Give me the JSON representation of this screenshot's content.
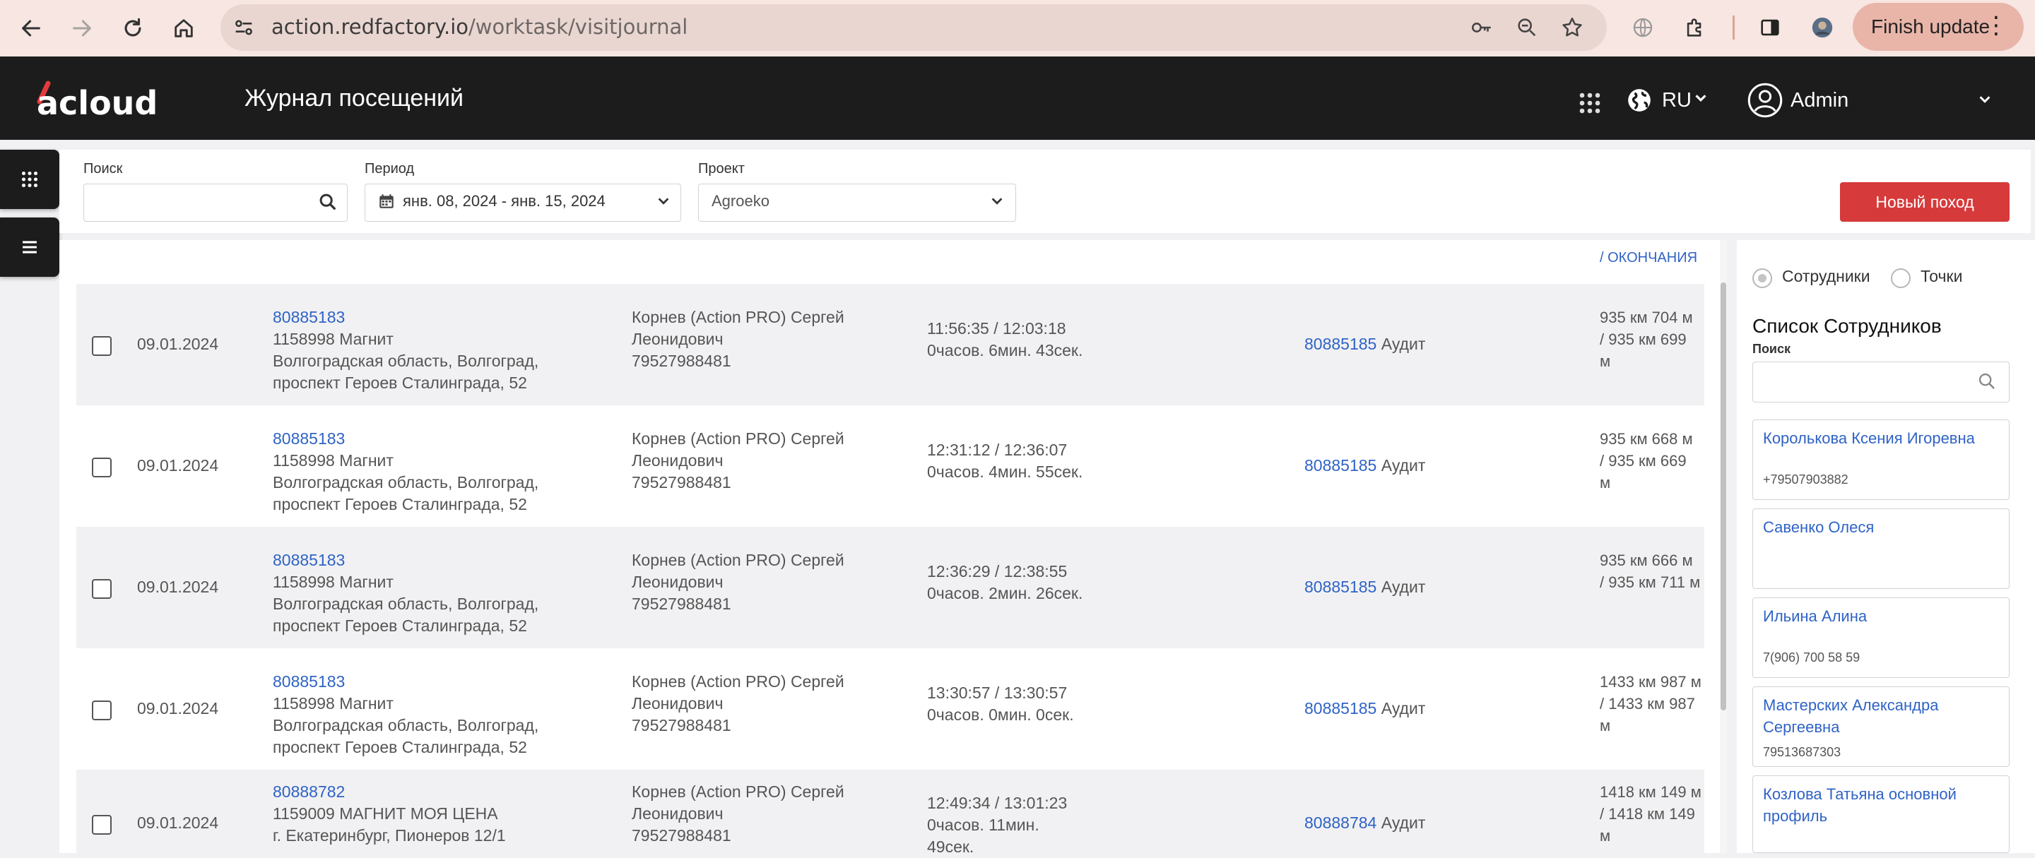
{
  "browser": {
    "url_host": "action.redfactory.io",
    "url_path": "/worktask/visitjournal",
    "finish_update_label": "Finish update"
  },
  "header": {
    "logo_text": "acloud",
    "title": "Журнал посещений",
    "lang": "RU",
    "user": "Admin"
  },
  "filters": {
    "search_label": "Поиск",
    "search_value": "",
    "period_label": "Период",
    "period_value": "янв. 08, 2024 - янв. 15, 2024",
    "project_label": "Проект",
    "project_value": "Agroeko",
    "new_trip_label": "Новый поход"
  },
  "table": {
    "end_column_header": "/ ОКОНЧАНИЯ",
    "rows": [
      {
        "date": "09.01.2024",
        "point_id": "80885183",
        "point_name": "1158998 Магнит",
        "addr1": "Волгоградская область, Волгоград,",
        "addr2": "проспект Героев Сталинграда, 52",
        "emp1": "Корнев (Action PRO) Сергей",
        "emp2": "Леонидович",
        "emp3": "79527988481",
        "time1": "11:56:35 / 12:03:18",
        "time2": "0часов. 6мин. 43сек.",
        "time3": "",
        "task_id": "80885185",
        "task_type": "Аудит",
        "dist1": "935 км 704 м",
        "dist2": "/ 935 км 699",
        "dist3": "м"
      },
      {
        "date": "09.01.2024",
        "point_id": "80885183",
        "point_name": "1158998 Магнит",
        "addr1": "Волгоградская область, Волгоград,",
        "addr2": "проспект Героев Сталинграда, 52",
        "emp1": "Корнев (Action PRO) Сергей",
        "emp2": "Леонидович",
        "emp3": "79527988481",
        "time1": "12:31:12 / 12:36:07",
        "time2": "0часов. 4мин. 55сек.",
        "time3": "",
        "task_id": "80885185",
        "task_type": "Аудит",
        "dist1": "935 км 668 м",
        "dist2": "/ 935 км 669",
        "dist3": "м"
      },
      {
        "date": "09.01.2024",
        "point_id": "80885183",
        "point_name": "1158998 Магнит",
        "addr1": "Волгоградская область, Волгоград,",
        "addr2": "проспект Героев Сталинграда, 52",
        "emp1": "Корнев (Action PRO) Сергей",
        "emp2": "Леонидович",
        "emp3": "79527988481",
        "time1": "12:36:29 / 12:38:55",
        "time2": "0часов. 2мин. 26сек.",
        "time3": "",
        "task_id": "80885185",
        "task_type": "Аудит",
        "dist1": "935 км 666 м",
        "dist2": "/ 935 км 711 м",
        "dist3": ""
      },
      {
        "date": "09.01.2024",
        "point_id": "80885183",
        "point_name": "1158998 Магнит",
        "addr1": "Волгоградская область, Волгоград,",
        "addr2": "проспект Героев Сталинграда, 52",
        "emp1": "Корнев (Action PRO) Сергей",
        "emp2": "Леонидович",
        "emp3": "79527988481",
        "time1": "13:30:57 / 13:30:57",
        "time2": "0часов. 0мин. 0сек.",
        "time3": "",
        "task_id": "80885185",
        "task_type": "Аудит",
        "dist1": "1433 км 987 м",
        "dist2": "/ 1433 км 987",
        "dist3": "м"
      },
      {
        "date": "09.01.2024",
        "point_id": "80888782",
        "point_name": "1159009 МАГНИТ МОЯ ЦЕНА",
        "addr1": "г. Екатеринбург, Пионеров 12/1",
        "addr2": "",
        "emp1": "Корнев (Action PRO) Сергей",
        "emp2": "Леонидович",
        "emp3": "79527988481",
        "time1": "12:49:34 / 13:01:23",
        "time2": "0часов. 11мин.",
        "time3": "49сек.",
        "task_id": "80888784",
        "task_type": "Аудит",
        "dist1": "1418 км 149 м",
        "dist2": "/ 1418 км 149",
        "dist3": "м"
      }
    ]
  },
  "right_panel": {
    "radio_employees": "Сотрудники",
    "radio_points": "Точки",
    "title": "Список Сотрудников",
    "search_label": "Поиск",
    "employees": [
      {
        "name": "Королькова Ксения Игоревна",
        "phone": "+79507903882"
      },
      {
        "name": "Савенко Олеся",
        "phone": ""
      },
      {
        "name": "Ильина Алина",
        "phone": "7(906) 700 58 59"
      },
      {
        "name": "Мастерских Александра Сергеевна",
        "phone": "79513687303"
      },
      {
        "name": "Козлова Татьяна основной профиль",
        "phone": ""
      }
    ]
  },
  "colors": {
    "brand_red": "#d63a3a",
    "header_bg": "#1c1c1c",
    "link_blue": "#2f63c6",
    "chrome_bg": "#f7e6e1"
  }
}
